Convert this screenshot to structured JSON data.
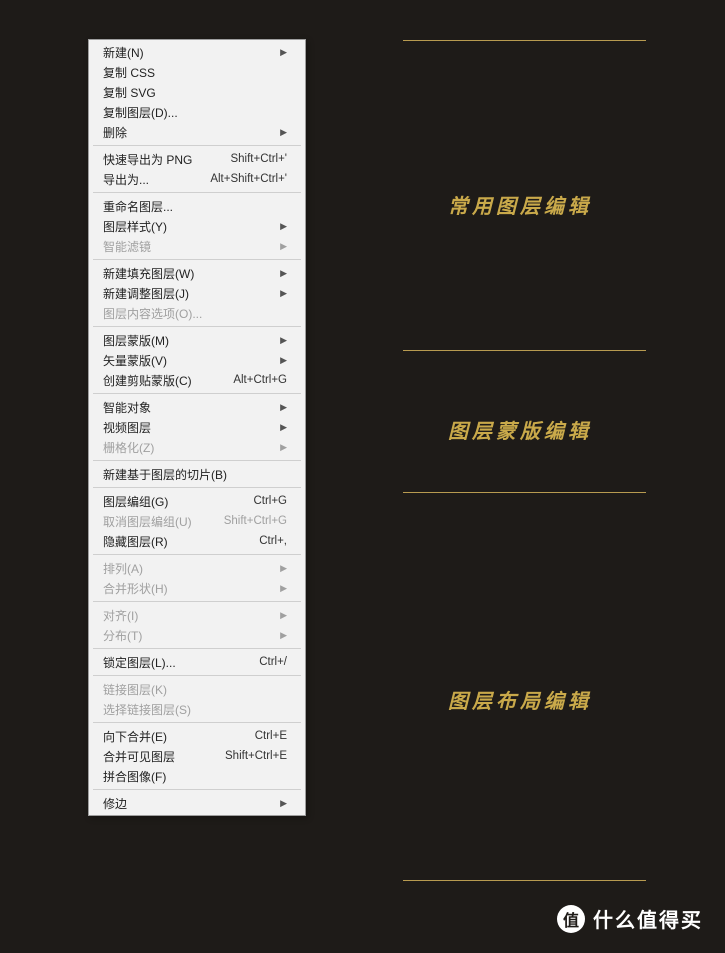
{
  "menu": [
    {
      "label": "新建(N)",
      "submenu": true
    },
    {
      "label": "复制 CSS"
    },
    {
      "label": "复制 SVG"
    },
    {
      "label": "复制图层(D)..."
    },
    {
      "label": "删除",
      "submenu": true
    },
    {
      "sep": true
    },
    {
      "label": "快速导出为 PNG",
      "shortcut": "Shift+Ctrl+'"
    },
    {
      "label": "导出为...",
      "shortcut": "Alt+Shift+Ctrl+'"
    },
    {
      "sep": true
    },
    {
      "label": "重命名图层..."
    },
    {
      "label": "图层样式(Y)",
      "submenu": true
    },
    {
      "label": "智能滤镜",
      "submenu": true,
      "disabled": true
    },
    {
      "sep": true
    },
    {
      "label": "新建填充图层(W)",
      "submenu": true
    },
    {
      "label": "新建调整图层(J)",
      "submenu": true
    },
    {
      "label": "图层内容选项(O)...",
      "disabled": true
    },
    {
      "sep": true
    },
    {
      "label": "图层蒙版(M)",
      "submenu": true
    },
    {
      "label": "矢量蒙版(V)",
      "submenu": true
    },
    {
      "label": "创建剪贴蒙版(C)",
      "shortcut": "Alt+Ctrl+G"
    },
    {
      "sep": true
    },
    {
      "label": "智能对象",
      "submenu": true
    },
    {
      "label": "视频图层",
      "submenu": true
    },
    {
      "label": "栅格化(Z)",
      "submenu": true,
      "disabled": true
    },
    {
      "sep": true
    },
    {
      "label": "新建基于图层的切片(B)"
    },
    {
      "sep": true
    },
    {
      "label": "图层编组(G)",
      "shortcut": "Ctrl+G"
    },
    {
      "label": "取消图层编组(U)",
      "shortcut": "Shift+Ctrl+G",
      "disabled": true
    },
    {
      "label": "隐藏图层(R)",
      "shortcut": "Ctrl+,"
    },
    {
      "sep": true
    },
    {
      "label": "排列(A)",
      "submenu": true,
      "disabled": true
    },
    {
      "label": "合并形状(H)",
      "submenu": true,
      "disabled": true
    },
    {
      "sep": true
    },
    {
      "label": "对齐(I)",
      "submenu": true,
      "disabled": true
    },
    {
      "label": "分布(T)",
      "submenu": true,
      "disabled": true
    },
    {
      "sep": true
    },
    {
      "label": "锁定图层(L)...",
      "shortcut": "Ctrl+/"
    },
    {
      "sep": true
    },
    {
      "label": "链接图层(K)",
      "disabled": true
    },
    {
      "label": "选择链接图层(S)",
      "disabled": true
    },
    {
      "sep": true
    },
    {
      "label": "向下合并(E)",
      "shortcut": "Ctrl+E"
    },
    {
      "label": "合并可见图层",
      "shortcut": "Shift+Ctrl+E"
    },
    {
      "label": "拼合图像(F)"
    },
    {
      "sep": true
    },
    {
      "label": "修边",
      "submenu": true
    }
  ],
  "annotations": {
    "section1": "常用图层编辑",
    "section2": "图层蒙版编辑",
    "section3": "图层布局编辑"
  },
  "watermark": {
    "icon": "值",
    "text": "什么值得买"
  }
}
